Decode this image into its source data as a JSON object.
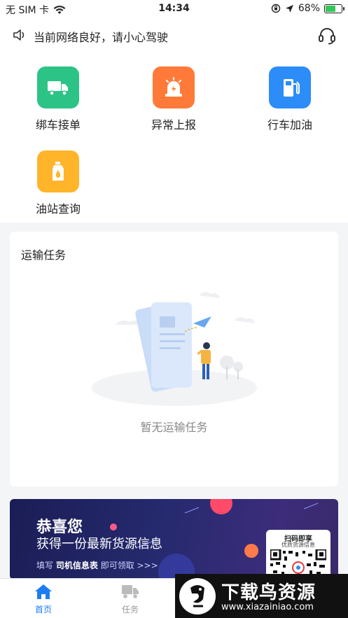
{
  "status_bar": {
    "carrier": "无 SIM 卡",
    "time": "14:34",
    "battery": "68%",
    "battery_level": 0.68
  },
  "notice": {
    "text": "当前网络良好，请小心驾驶"
  },
  "menu": {
    "items": [
      {
        "label": "绑车接单",
        "icon": "truck-icon",
        "color": "#2cc486"
      },
      {
        "label": "异常上报",
        "icon": "alarm-icon",
        "color": "#ff7a38"
      },
      {
        "label": "行车加油",
        "icon": "fuel-pump-icon",
        "color": "#2c8cf8"
      },
      {
        "label": "油站查询",
        "icon": "oil-bottle-icon",
        "color": "#ffb42a"
      }
    ]
  },
  "task": {
    "title": "运输任务",
    "empty_text": "暂无运输任务"
  },
  "banner": {
    "line1": "恭喜您",
    "line2": "获得一份最新货源信息",
    "line3_prefix": "填写",
    "line3_bold": "司机信息表",
    "line3_suffix": "即可领取 >>>",
    "qr_title": "扫码即享",
    "qr_subtitle": "优质货源信息"
  },
  "tabbar": {
    "tabs": [
      {
        "label": "首页",
        "icon": "home-icon",
        "active": true
      },
      {
        "label": "任务",
        "icon": "truck-icon",
        "active": false
      }
    ],
    "active_color": "#1e7cf2",
    "inactive_color": "#999999"
  },
  "watermark": {
    "cn": "下载鸟资源",
    "en": "www.xiazainiao.com"
  }
}
